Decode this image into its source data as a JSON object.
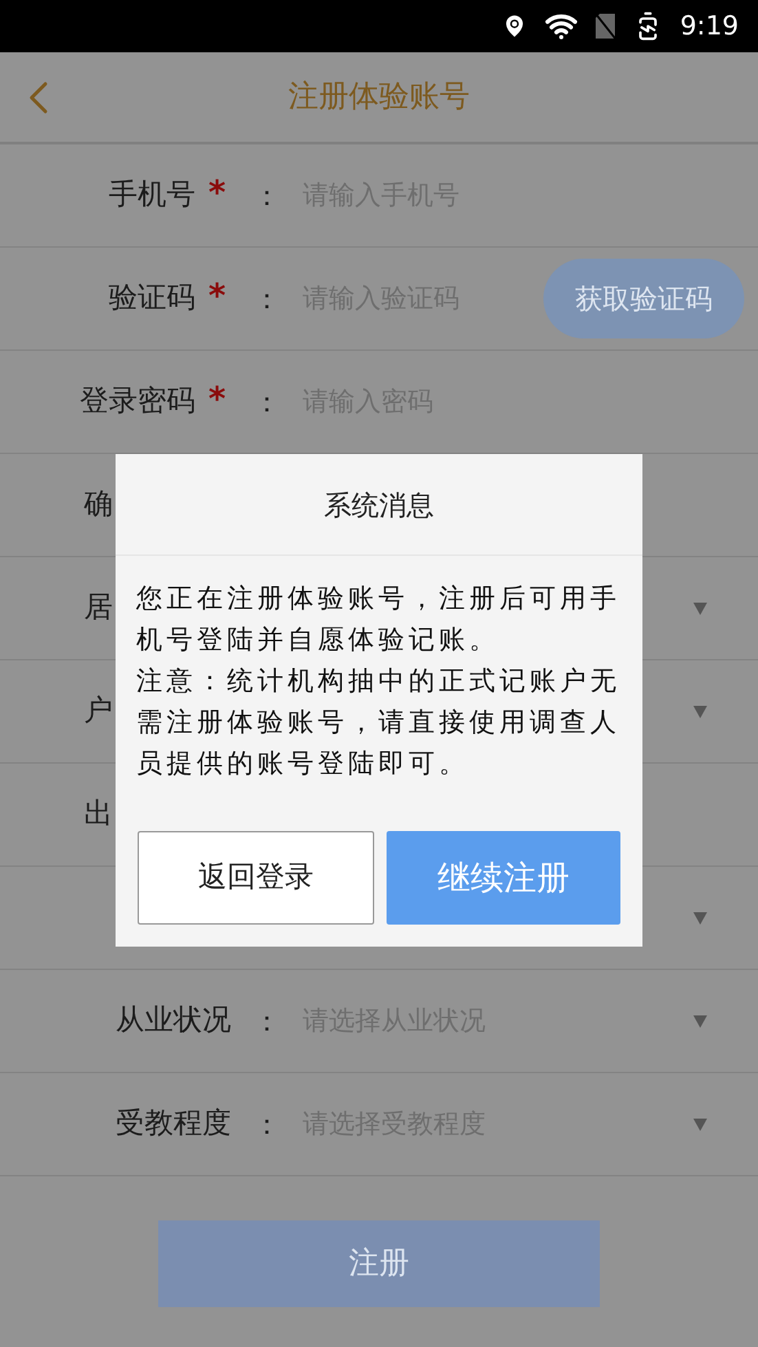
{
  "status_bar": {
    "time": "9:19"
  },
  "header": {
    "title": "注册体验账号"
  },
  "form": {
    "rows": [
      {
        "kind": "text",
        "label": "手机号",
        "mark": "*",
        "colon": "：",
        "placeholder": "请输入手机号"
      },
      {
        "kind": "code",
        "label": "验证码",
        "mark": "*",
        "colon": "：",
        "placeholder": "请输入验证码",
        "button": "获取验证码"
      },
      {
        "kind": "text",
        "label": "登录密码",
        "mark": "*",
        "colon": "：",
        "placeholder": "请输入密码"
      },
      {
        "kind": "text",
        "label": "确"
      },
      {
        "kind": "select",
        "label": "居"
      },
      {
        "kind": "select",
        "label": "户"
      },
      {
        "kind": "text",
        "label": "出"
      },
      {
        "kind": "select"
      },
      {
        "kind": "select",
        "label": "从业状况",
        "colon": "：",
        "placeholder": "请选择从业状况"
      },
      {
        "kind": "select",
        "label": "受教程度",
        "colon": "：",
        "placeholder": "请选择受教程度"
      }
    ]
  },
  "submit": "注册",
  "dialog": {
    "title": "系统消息",
    "paragraphs": [
      "您正在注册体验账号，注册后可用手机号登陆并自愿体验记账。",
      "注意：统计机构抽中的正式记账户无需注册体验账号，请直接使用调查人员提供的账号登陆即可。"
    ],
    "buttons": [
      {
        "label": "返回登录",
        "kind": "secondary"
      },
      {
        "label": "继续注册",
        "kind": "primary"
      }
    ]
  }
}
